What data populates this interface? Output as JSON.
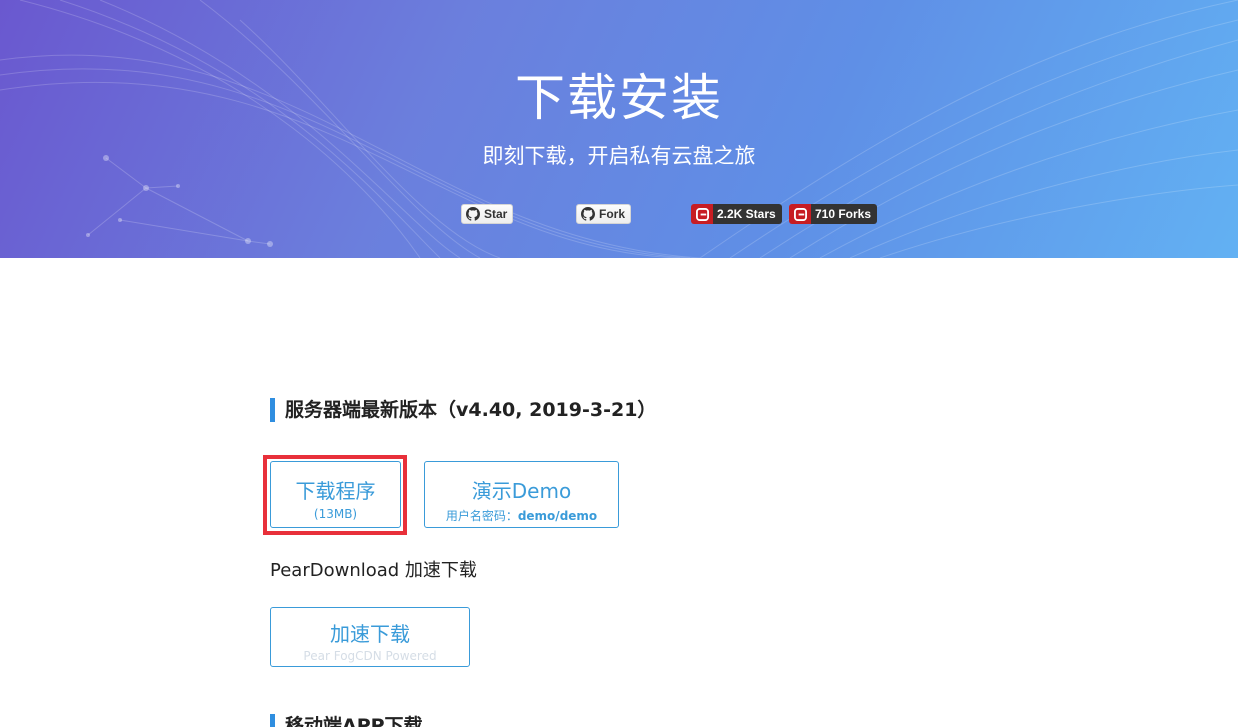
{
  "hero": {
    "title": "下载安装",
    "subtitle": "即刻下载，开启私有云盘之旅",
    "github_star_label": "Star",
    "github_fork_label": "Fork",
    "gitee_stars": "2.2K Stars",
    "gitee_forks": "710 Forks",
    "gradient": [
      "#6a58cf",
      "#62b1f3"
    ]
  },
  "server": {
    "title": "服务器端最新版本（v4.40, 2019-3-21）",
    "download_label": "下载程序",
    "download_size": "(13MB)",
    "demo_label": "演示Demo",
    "demo_cred_prefix": "用户名密码：",
    "demo_cred_value": "demo/demo",
    "pear_text": "PearDownload 加速下载",
    "accel_label": "加速下载",
    "accel_sub": "Pear FogCDN Powered"
  },
  "mobile": {
    "title": "移动端APP下载"
  },
  "colors": {
    "accent": "#3a9bd9",
    "highlight": "#e8303a",
    "gitee_red": "#c71d23"
  }
}
